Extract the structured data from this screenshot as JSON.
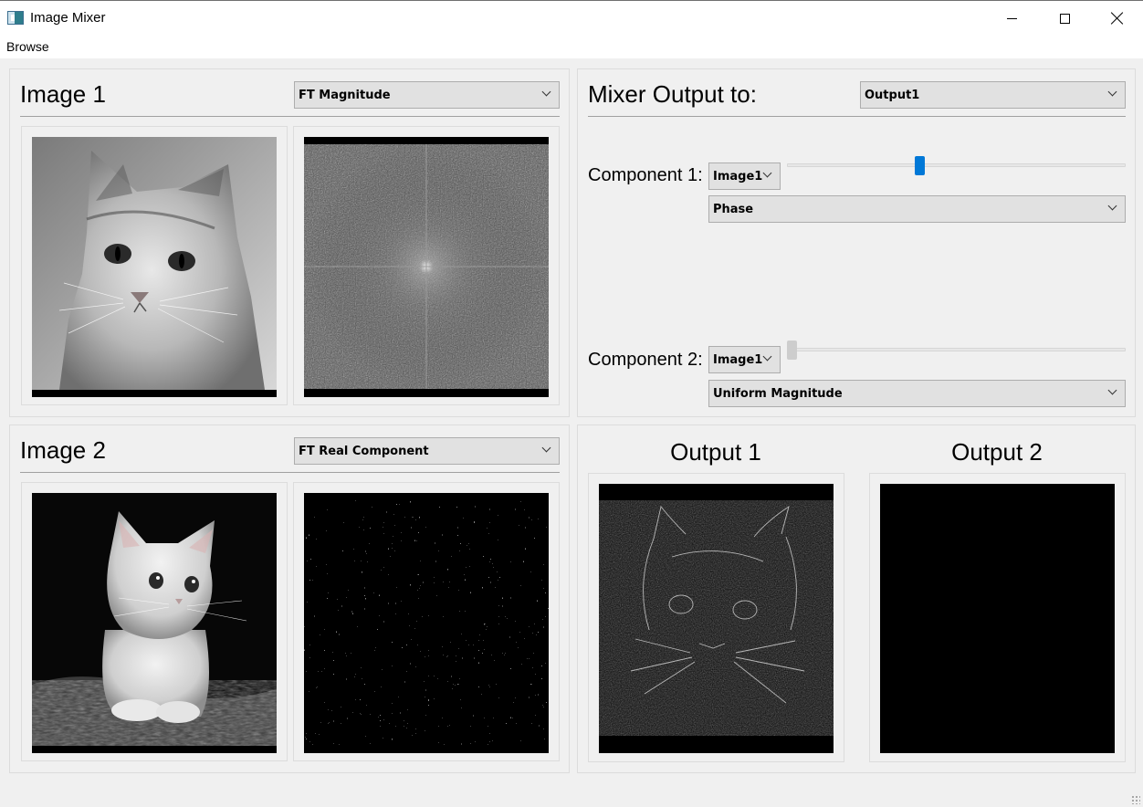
{
  "window": {
    "title": "Image Mixer",
    "icon": "app-window-icon",
    "controls": [
      "minimize-icon",
      "maximize-icon",
      "close-icon"
    ]
  },
  "menu": {
    "items": [
      {
        "label": "Browse"
      }
    ]
  },
  "image1": {
    "title": "Image 1",
    "view_select": {
      "value": "FT Magnitude"
    }
  },
  "image2": {
    "title": "Image 2",
    "view_select": {
      "value": "FT Real Component"
    }
  },
  "mixer": {
    "title": "Mixer Output to:",
    "output_select": {
      "value": "Output1"
    },
    "component1": {
      "label": "Component 1:",
      "image_select": {
        "value": "Image1"
      },
      "type_select": {
        "value": "Phase"
      },
      "slider_value_fraction": 0.39,
      "slider_enabled": true
    },
    "component2": {
      "label": "Component 2:",
      "image_select": {
        "value": "Image1"
      },
      "type_select": {
        "value": "Uniform Magnitude"
      },
      "slider_value_fraction": 0.0,
      "slider_enabled": false
    }
  },
  "outputs": {
    "output1": {
      "title": "Output 1"
    },
    "output2": {
      "title": "Output 2"
    }
  },
  "colors": {
    "slider_accent": "#0078d7",
    "window_bg": "#f0f0f0",
    "viewer_bg": "#000000"
  }
}
